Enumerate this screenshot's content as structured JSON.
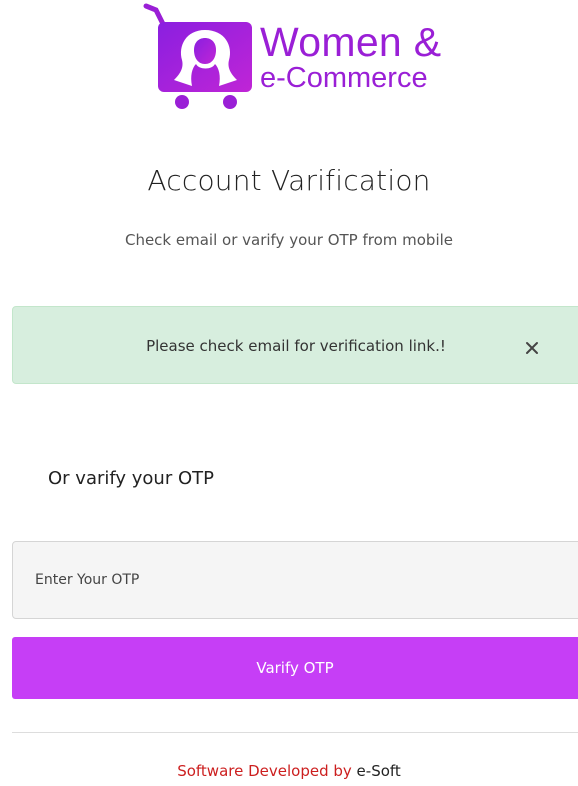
{
  "brand": {
    "line1": "Women &",
    "line2": "e-Commerce",
    "accent_color": "#9a1fd6"
  },
  "page": {
    "title": "Account Varification",
    "subtitle": "Check email or varify your OTP from mobile"
  },
  "alert": {
    "message": "Please check email for verification link.!",
    "close_icon": "close-icon",
    "background_color": "#d7eede"
  },
  "otp": {
    "heading": "Or varify your OTP",
    "placeholder": "Enter Your OTP",
    "value": "",
    "button_label": "Varify OTP",
    "button_color": "#c63ef6"
  },
  "footer": {
    "prefix": "Software Developed by",
    "brand": "e-Soft",
    "prefix_color": "#cc1f1f"
  }
}
